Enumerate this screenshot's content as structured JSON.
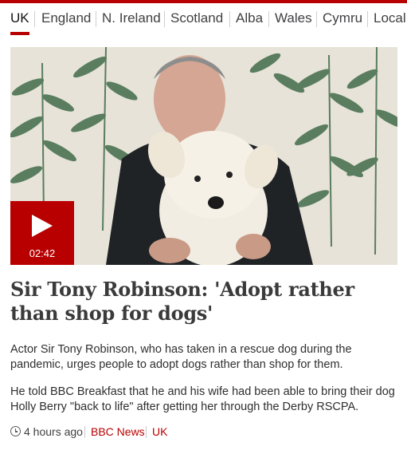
{
  "nav": {
    "items": [
      {
        "label": "UK",
        "active": true
      },
      {
        "label": "England",
        "active": false
      },
      {
        "label": "N. Ireland",
        "active": false
      },
      {
        "label": "Scotland",
        "active": false
      },
      {
        "label": "Alba",
        "active": false
      },
      {
        "label": "Wales",
        "active": false
      },
      {
        "label": "Cymru",
        "active": false
      },
      {
        "label": "Local",
        "active": false
      }
    ]
  },
  "colors": {
    "brand_red": "#b80000",
    "wallpaper": "#e7e3d8",
    "leaf_green": "#3f6b49"
  },
  "media": {
    "icon": "play-icon",
    "duration": "02:42"
  },
  "article": {
    "headline": "Sir Tony Robinson: 'Adopt rather than shop for dogs'",
    "summary_1": "Actor Sir Tony Robinson, who has taken in a rescue dog during the pandemic, urges people to adopt dogs rather than shop for them.",
    "summary_2": "He told BBC Breakfast that he and his wife had been able to bring their dog Holly Berry \"back to life\" after getting her through the Derby RSCPA.",
    "time": "4 hours ago",
    "source": "BBC News",
    "section": "UK"
  }
}
